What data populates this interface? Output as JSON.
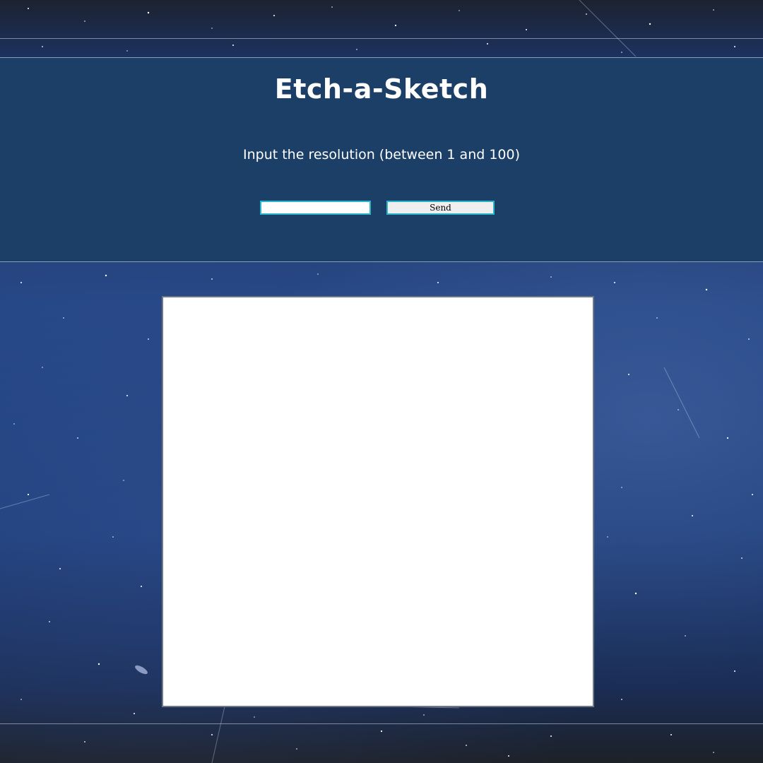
{
  "app": {
    "title": "Etch-a-Sketch"
  },
  "prompt": {
    "text": "Input the resolution (between 1 and 100)"
  },
  "resolution_input": {
    "value": "",
    "placeholder": ""
  },
  "send_button": {
    "label": "Send"
  },
  "colors": {
    "header_background": "#1b3f66",
    "control_border": "#28b6c8",
    "canvas_background": "#ffffff",
    "text": "#ffffff"
  },
  "background": {
    "image_description_icon": "starfield-background"
  }
}
